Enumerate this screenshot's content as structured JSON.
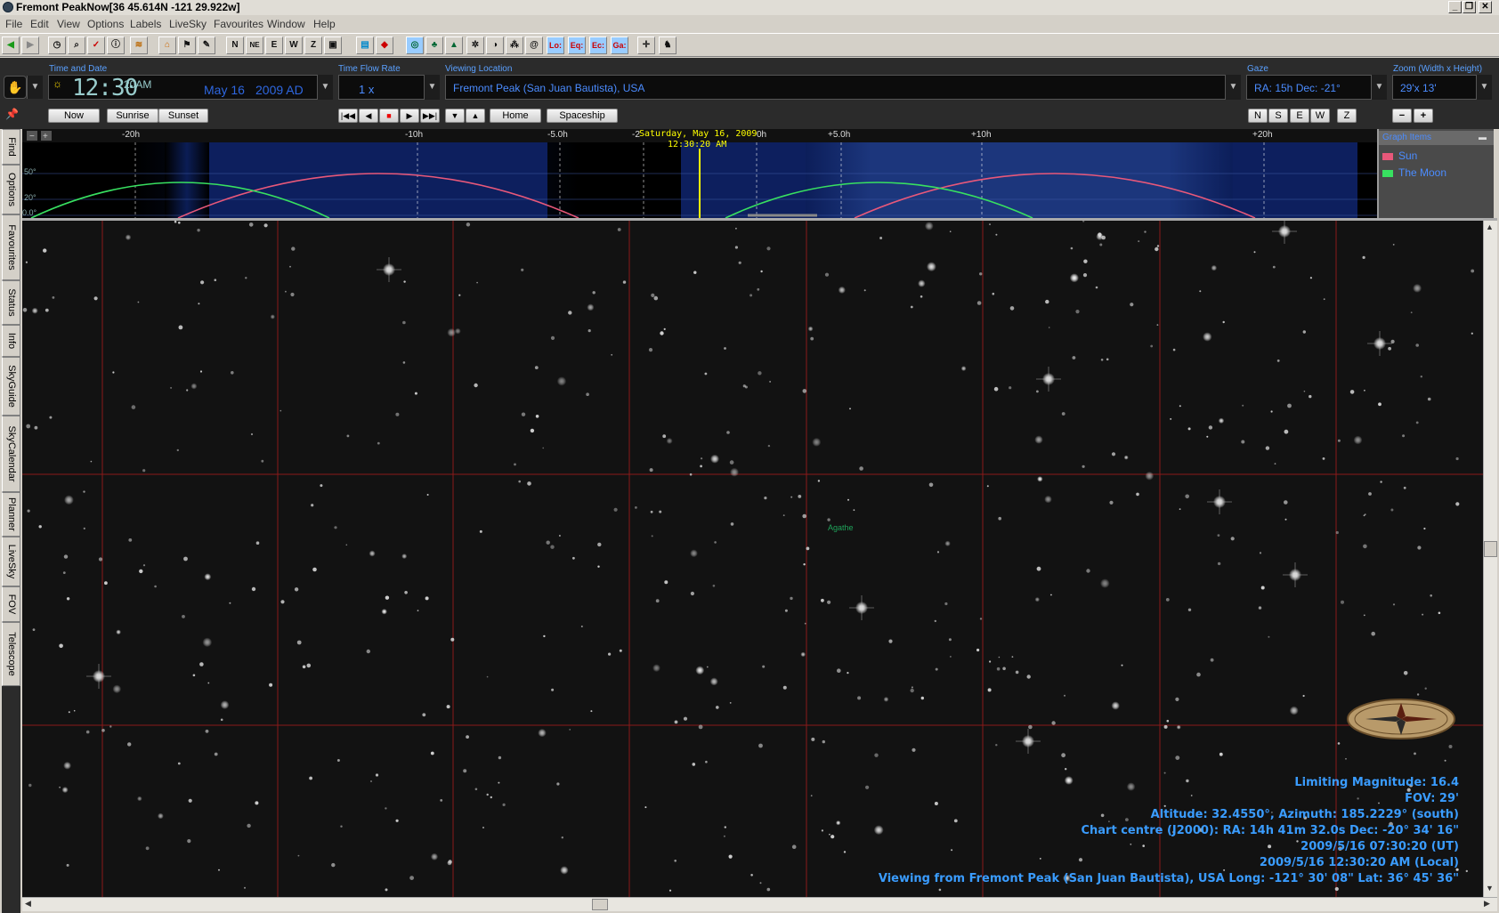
{
  "window": {
    "title": "Fremont PeakNow[36  45.614N  -121 29.922w]",
    "min": "_",
    "restore": "❐",
    "close": "✕"
  },
  "menu": [
    "File",
    "Edit",
    "View",
    "Options",
    "Labels",
    "LiveSky",
    "Favourites",
    "Window",
    "Help"
  ],
  "toolbar_icons": [
    "back-icon",
    "forward-icon",
    "history-icon",
    "find-icon",
    "check-icon",
    "info-icon",
    "layers-icon",
    "home-icon",
    "flag-icon",
    "tool-icon",
    "north-icon",
    "northeast-icon",
    "east-icon",
    "west-icon",
    "zenith-icon",
    "telescope-icon",
    "screen-icon",
    "tag-icon",
    "chart-icon",
    "tree-icon",
    "mountain-icon",
    "settings-icon",
    "moon-icon",
    "constellation-icon",
    "spiral-icon",
    "local-grid-icon",
    "equatorial-grid-icon",
    "ecliptic-grid-icon",
    "galactic-grid-icon",
    "crosshair-icon",
    "walker-icon"
  ],
  "toolbar_text": {
    "lo": "Lo:",
    "eq": "Eq:",
    "ec": "Ec:",
    "ga": "Ga:",
    "n": "N",
    "ne": "NE",
    "e": "E",
    "w": "W",
    "z": "Z"
  },
  "controls": {
    "time_caption": "Time and Date",
    "time": "12:30",
    "ampm": "20AM",
    "date": "May 16",
    "year": "2009 AD",
    "rate_caption": "Time Flow Rate",
    "rate": "1 x",
    "location_caption": "Viewing Location",
    "location": "Fremont Peak (San Juan Bautista), USA",
    "gaze_caption": "Gaze",
    "gaze": "RA: 15h Dec: -21°",
    "zoom_caption": "Zoom (Width x Height)",
    "zoom": "29'x 13'",
    "now": "Now",
    "sunrise": "Sunrise",
    "sunset": "Sunset",
    "home": "Home",
    "spaceship": "Spaceship",
    "dir_n": "N",
    "dir_s": "S",
    "dir_e": "E",
    "dir_w": "W",
    "dir_z": "Z",
    "zoom_minus": "−",
    "zoom_plus": "+"
  },
  "left_tabs": [
    "Find",
    "Options",
    "Favourites",
    "Status",
    "Info",
    "SkyGuide",
    "SkyCalendar",
    "Planner",
    "LiveSky",
    "FOV",
    "Telescope"
  ],
  "timeline": {
    "date_label": "Saturday, May 16, 2009",
    "time_label": "12:30:20 AM",
    "ticks": [
      "-20h",
      "-10h",
      "-5.0h",
      "-2",
      "0h",
      "+5.0h",
      "+10h",
      "+20h"
    ],
    "alt_labels": [
      "50°",
      "20°",
      "0.0°"
    ],
    "legend": {
      "header": "Graph Items",
      "sun": "Sun",
      "moon": "The Moon",
      "sun_color": "#e8587a",
      "moon_color": "#38e060"
    }
  },
  "sky": {
    "object_label": "Agathe",
    "info": [
      "Limiting Magnitude: 16.4",
      "FOV: 29'",
      "Altitude: 32.4550°, Azimuth: 185.2229° (south)",
      "Chart centre (J2000): RA: 14h 41m 32.0s Dec: -20° 34' 16\"",
      "2009/5/16 07:30:20 (UT)",
      "2009/5/16 12:30:20 AM (Local)",
      "Viewing from Fremont Peak (San Juan Bautista), USA    Long: -121° 30' 08\" Lat: 36° 45' 36\""
    ]
  }
}
